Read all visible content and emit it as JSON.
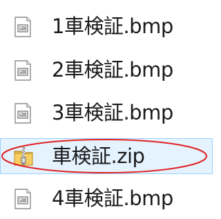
{
  "files": [
    {
      "name": "1車検証.bmp",
      "icon": "bitmap-image-icon",
      "selected": false
    },
    {
      "name": "2車検証.bmp",
      "icon": "bitmap-image-icon",
      "selected": false
    },
    {
      "name": "3車検証.bmp",
      "icon": "bitmap-image-icon",
      "selected": false
    },
    {
      "name": "車検証.zip",
      "icon": "zip-folder-icon",
      "selected": true
    },
    {
      "name": "4車検証.bmp",
      "icon": "bitmap-image-icon",
      "selected": false
    }
  ],
  "colors": {
    "selection_background": "#e5f3ff",
    "selection_border": "#99d1ff",
    "annotation_ellipse": "#e02020",
    "text": "#1a1a1a"
  }
}
